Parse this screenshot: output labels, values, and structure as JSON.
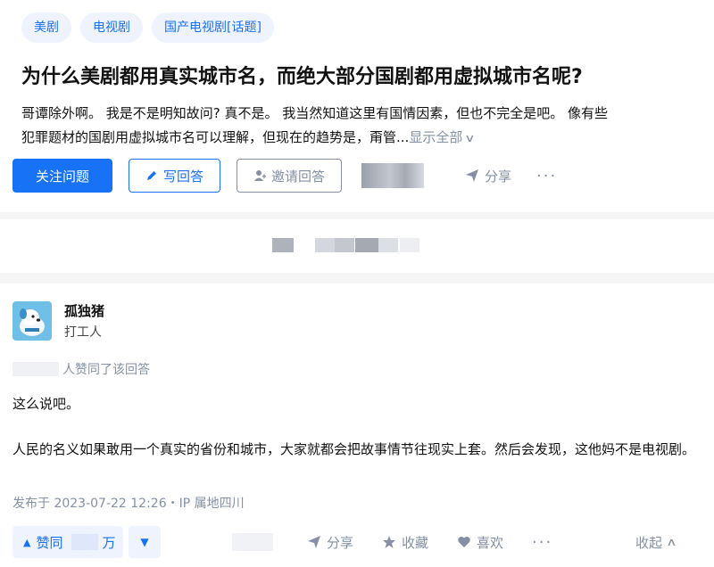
{
  "tags": [
    "美剧",
    "电视剧",
    "国产电视剧[话题]"
  ],
  "question": {
    "title": "为什么美剧都用真实城市名，而绝大部分国剧都用虚拟城市名呢?",
    "detail_line1": "哥谭除外啊。 我是不是明知故问? 真不是。 我当然知道这里有国情因素，但也不完全是吧。 像有些",
    "detail_line2": "犯罪题材的国剧用虚拟城市名可以理解，但现在的趋势是，甭管...",
    "show_all": "显示全部",
    "follow_button": "关注问题",
    "write_answer_button": "写回答",
    "invite_button": "邀请回答",
    "share_label": "分享",
    "more_label": "···"
  },
  "answer": {
    "author_name": "孤独猪",
    "author_bio": "打工人",
    "voters_text": "人赞同了该回答",
    "paragraph1": "这么说吧。",
    "paragraph2": "人民的名义如果敢用一个真实的省份和城市，大家就都会把故事情节往现实上套。然后会发现，这他妈不是电视剧。",
    "meta": "发布于 2023-07-22 12:26・IP 属地四川",
    "upvote_label": "赞同",
    "upvote_suffix": "万",
    "share_label": "分享",
    "favorite_label": "收藏",
    "like_label": "喜欢",
    "more_label": "···",
    "collapse_label": "收起"
  },
  "colors": {
    "accent": "#1772f6",
    "muted": "#8590a6",
    "tag_bg": "#eef3fd"
  }
}
